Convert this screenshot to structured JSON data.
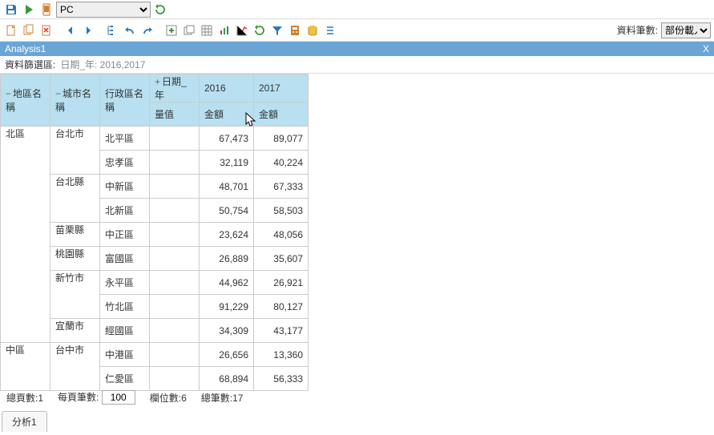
{
  "toolbar": {
    "device_select": "PC",
    "data_rows_label": "資料筆數:",
    "load_mode": "部份載入"
  },
  "title": "Analysis1",
  "filter": {
    "label": "資料篩選區:",
    "value": "日期_年: 2016,2017"
  },
  "pivot": {
    "row_dims": [
      "地區名稱",
      "城市名稱",
      "行政區名稱"
    ],
    "col_dim_label": "日期_年",
    "measure_label": "量值",
    "value_label": "金額",
    "years": [
      "2016",
      "2017"
    ],
    "rows": [
      {
        "region": "北區",
        "city": "台北市",
        "district": "北平區",
        "v": [
          "67,473",
          "89,077"
        ]
      },
      {
        "region": "",
        "city": "",
        "district": "忠孝區",
        "v": [
          "32,119",
          "40,224"
        ]
      },
      {
        "region": "",
        "city": "台北縣",
        "district": "中新區",
        "v": [
          "48,701",
          "67,333"
        ]
      },
      {
        "region": "",
        "city": "",
        "district": "北新區",
        "v": [
          "50,754",
          "58,503"
        ]
      },
      {
        "region": "",
        "city": "苗栗縣",
        "district": "中正區",
        "v": [
          "23,624",
          "48,056"
        ]
      },
      {
        "region": "",
        "city": "桃園縣",
        "district": "富國區",
        "v": [
          "26,889",
          "35,607"
        ]
      },
      {
        "region": "",
        "city": "新竹市",
        "district": "永平區",
        "v": [
          "44,962",
          "26,921"
        ]
      },
      {
        "region": "",
        "city": "",
        "district": "竹北區",
        "v": [
          "91,229",
          "80,127"
        ]
      },
      {
        "region": "",
        "city": "宜蘭市",
        "district": "經國區",
        "v": [
          "34,309",
          "43,177"
        ]
      },
      {
        "region": "中區",
        "city": "台中市",
        "district": "中港區",
        "v": [
          "26,656",
          "13,360"
        ]
      },
      {
        "region": "",
        "city": "",
        "district": "仁愛區",
        "v": [
          "68,894",
          "56,333"
        ]
      }
    ]
  },
  "footer": {
    "total_pages_label": "總頁數:",
    "total_pages": "1",
    "per_page_label": "每頁筆數:",
    "per_page": "100",
    "col_count_label": "欄位數:",
    "col_count": "6",
    "row_count_label": "總筆數:",
    "row_count": "17"
  },
  "tabs": [
    "分析1"
  ],
  "chart_data": {
    "type": "table",
    "title": "Analysis1",
    "row_dimensions": [
      "地區名稱",
      "城市名稱",
      "行政區名稱"
    ],
    "column_dimension": "日期_年",
    "measure": "金額",
    "columns": [
      "2016",
      "2017"
    ],
    "data": [
      {
        "地區名稱": "北區",
        "城市名稱": "台北市",
        "行政區名稱": "北平區",
        "2016": 67473,
        "2017": 89077
      },
      {
        "地區名稱": "北區",
        "城市名稱": "台北市",
        "行政區名稱": "忠孝區",
        "2016": 32119,
        "2017": 40224
      },
      {
        "地區名稱": "北區",
        "城市名稱": "台北縣",
        "行政區名稱": "中新區",
        "2016": 48701,
        "2017": 67333
      },
      {
        "地區名稱": "北區",
        "城市名稱": "台北縣",
        "行政區名稱": "北新區",
        "2016": 50754,
        "2017": 58503
      },
      {
        "地區名稱": "北區",
        "城市名稱": "苗栗縣",
        "行政區名稱": "中正區",
        "2016": 23624,
        "2017": 48056
      },
      {
        "地區名稱": "北區",
        "城市名稱": "桃園縣",
        "行政區名稱": "富國區",
        "2016": 26889,
        "2017": 35607
      },
      {
        "地區名稱": "北區",
        "城市名稱": "新竹市",
        "行政區名稱": "永平區",
        "2016": 44962,
        "2017": 26921
      },
      {
        "地區名稱": "北區",
        "城市名稱": "新竹市",
        "行政區名稱": "竹北區",
        "2016": 91229,
        "2017": 80127
      },
      {
        "地區名稱": "北區",
        "城市名稱": "宜蘭市",
        "行政區名稱": "經國區",
        "2016": 34309,
        "2017": 43177
      },
      {
        "地區名稱": "中區",
        "城市名稱": "台中市",
        "行政區名稱": "中港區",
        "2016": 26656,
        "2017": 13360
      },
      {
        "地區名稱": "中區",
        "城市名稱": "台中市",
        "行政區名稱": "仁愛區",
        "2016": 68894,
        "2017": 56333
      }
    ]
  }
}
